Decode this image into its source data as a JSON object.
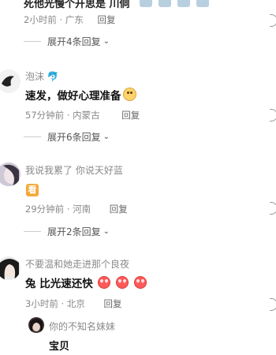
{
  "top": {
    "cut_text": "死他光慢个开思是 川侗",
    "meta_time": "2小时前",
    "meta_location": "广东",
    "reply": "回复",
    "expand": "展开4条回复"
  },
  "comments": [
    {
      "username": "泡沫",
      "text": "速发，做好心理准备",
      "time": "57分钟前",
      "location": "内蒙古",
      "reply": "回复",
      "expand": "展开6条回复"
    },
    {
      "username": "我说我累了 你说天好蓝",
      "sticker": "看",
      "time": "29分钟前",
      "location": "河南",
      "reply": "回复",
      "expand": "展开2条回复"
    },
    {
      "username": "不要温和她走进那个良夜",
      "text": "兔 比光速还快",
      "time": "3小时前",
      "location": "北京",
      "reply": "回复"
    }
  ],
  "reply_item": {
    "username": "你的不知名妹妹",
    "text": "宝贝"
  },
  "colors": {
    "meta": "#888888",
    "emoji_red": "#ff5a5a",
    "emoji_yellow": "#ffd36b",
    "sticker": "#f4a93a"
  }
}
